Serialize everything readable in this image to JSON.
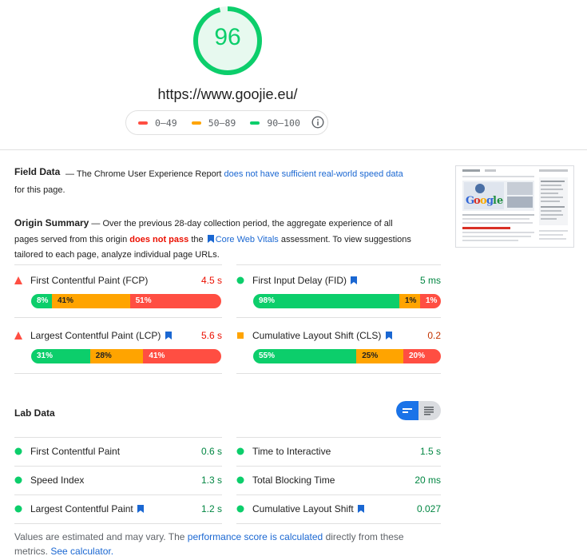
{
  "score": {
    "value": "96",
    "fraction": 0.96,
    "color": "#0cce6b"
  },
  "url": "https://www.goojie.eu/",
  "legend": [
    {
      "label": "0–49",
      "color": "#ff4e42"
    },
    {
      "label": "50–89",
      "color": "#ffa400"
    },
    {
      "label": "90–100",
      "color": "#0cce6b"
    }
  ],
  "field_data": {
    "title": "Field Data",
    "text_before": "— The Chrome User Experience Report",
    "link": "does not have sufficient real-world speed data",
    "text_after": "for this page."
  },
  "origin_summary": {
    "title": "Origin Summary",
    "text_before": "— Over the previous 28-day collection period, the aggregate experience of all pages served from this origin",
    "fail_text": "does not pass",
    "the": "the",
    "link": "Core Web Vitals",
    "text_after": "assessment. To view suggestions tailored to each page, analyze individual page URLs."
  },
  "origin_metrics": [
    {
      "name": "First Contentful Paint (FCP)",
      "value": "4.5 s",
      "status": "fail",
      "value_color": "#eb0f00",
      "bookmark": false,
      "dist": [
        {
          "label": "8%",
          "fraction": 0.08
        },
        {
          "label": "41%",
          "fraction": 0.41
        },
        {
          "label": "51%",
          "fraction": 0.51
        }
      ]
    },
    {
      "name": "First Input Delay (FID)",
      "value": "5 ms",
      "status": "pass",
      "value_color": "#018642",
      "bookmark": true,
      "dist": [
        {
          "label": "98%",
          "fraction": 0.98
        },
        {
          "label": "1%",
          "fraction": 0.01
        },
        {
          "label": "1%",
          "fraction": 0.01
        }
      ]
    },
    {
      "name": "Largest Contentful Paint (LCP)",
      "value": "5.6 s",
      "status": "fail",
      "value_color": "#eb0f00",
      "bookmark": true,
      "dist": [
        {
          "label": "31%",
          "fraction": 0.31
        },
        {
          "label": "28%",
          "fraction": 0.28
        },
        {
          "label": "41%",
          "fraction": 0.41
        }
      ]
    },
    {
      "name": "Cumulative Layout Shift (CLS)",
      "value": "0.2",
      "status": "average",
      "value_color": "#c33300",
      "bookmark": true,
      "dist": [
        {
          "label": "55%",
          "fraction": 0.55
        },
        {
          "label": "25%",
          "fraction": 0.25
        },
        {
          "label": "20%",
          "fraction": 0.2
        }
      ]
    }
  ],
  "lab_data": {
    "title": "Lab Data",
    "metrics": [
      {
        "name": "First Contentful Paint",
        "value": "0.6 s",
        "bookmark": false
      },
      {
        "name": "Time to Interactive",
        "value": "1.5 s",
        "bookmark": false
      },
      {
        "name": "Speed Index",
        "value": "1.3 s",
        "bookmark": false
      },
      {
        "name": "Total Blocking Time",
        "value": "20 ms",
        "bookmark": false
      },
      {
        "name": "Largest Contentful Paint",
        "value": "1.2 s",
        "bookmark": true
      },
      {
        "name": "Cumulative Layout Shift",
        "value": "0.027",
        "bookmark": true
      }
    ],
    "value_color": "#018642"
  },
  "footer": {
    "text_before": "Values are estimated and may vary. The",
    "link1": "performance score is calculated",
    "text_middle": "directly from these metrics.",
    "link2": "See calculator."
  },
  "colors": {
    "good": "#0cce6b",
    "average": "#ffa400",
    "poor": "#ff4e42",
    "link": "#1a67d2"
  }
}
